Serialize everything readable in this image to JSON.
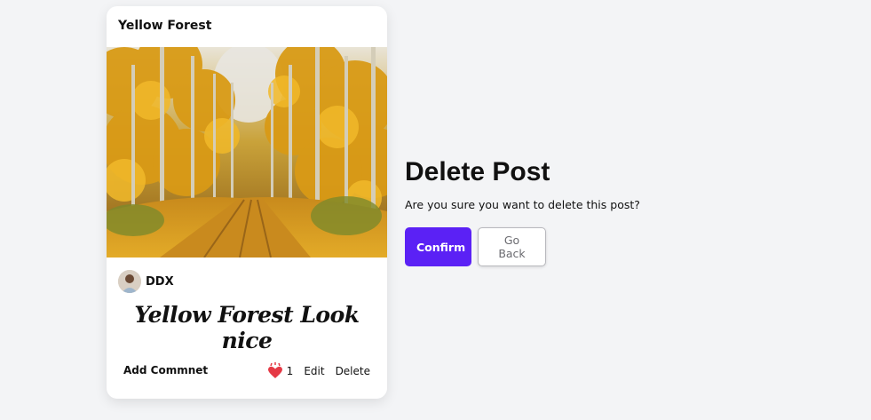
{
  "post": {
    "title": "Yellow Forest",
    "image_icon": "forest-photo",
    "author": "DDX",
    "caption": "Yellow Forest Look nice",
    "add_comment_label": "Add Commnet",
    "like_count": "1",
    "edit_label": "Edit",
    "delete_label": "Delete"
  },
  "dialog": {
    "title": "Delete Post",
    "message": "Are you sure you want to delete this post?",
    "confirm_label": "Confirm",
    "back_label": "Go Back"
  },
  "colors": {
    "background": "#f3f4f6",
    "confirm": "#5b21f5",
    "heart": "#e53945"
  }
}
